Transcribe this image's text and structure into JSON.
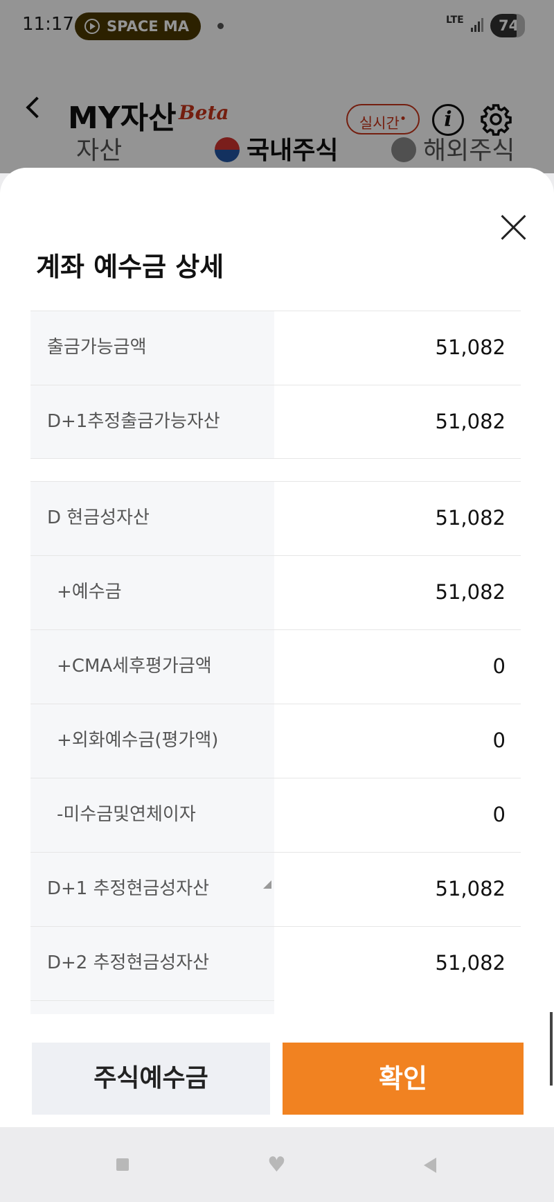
{
  "status_bar": {
    "time": "11:17",
    "media_label": "SPACE MA",
    "network": "LTE",
    "battery": "74"
  },
  "header": {
    "title": "MY자산",
    "beta": "Beta",
    "realtime_label": "실시간",
    "info_glyph": "i"
  },
  "tabs": [
    {
      "label": "자산"
    },
    {
      "label": "국내주식"
    },
    {
      "label": "해외주식"
    }
  ],
  "sheet": {
    "title": "계좌 예수금 상세",
    "group1": [
      {
        "label": "출금가능금액",
        "value": "51,082"
      },
      {
        "label": "D+1추정출금가능자산",
        "value": "51,082"
      }
    ],
    "group2": [
      {
        "label": "D 현금성자산",
        "value": "51,082"
      },
      {
        "label": "+예수금",
        "value": "51,082"
      },
      {
        "label": "+CMA세후평가금액",
        "value": "0"
      },
      {
        "label": "+외화예수금(평가액)",
        "value": "0"
      },
      {
        "label": "-미수금및연체이자",
        "value": "0"
      },
      {
        "label": "D+1 추정현금성자산",
        "value": "51,082"
      },
      {
        "label": "D+2 추정현금성자산",
        "value": "51,082"
      }
    ]
  },
  "buttons": {
    "stock_deposit": "주식예수금",
    "confirm": "확인"
  },
  "colors": {
    "accent_orange": "#f18221",
    "brand_red": "#c8341a"
  }
}
